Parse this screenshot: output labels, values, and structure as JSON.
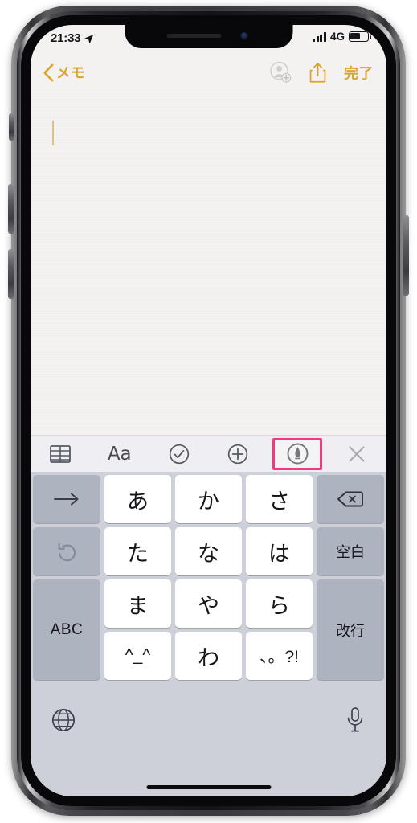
{
  "device": {
    "name": "iPhone X",
    "frame_color": "#3a3a3e"
  },
  "status_bar": {
    "time": "21:33",
    "location_icon": "location-arrow-icon",
    "signal_icon": "signal-bars-icon",
    "signal_bars": 4,
    "network": "4G",
    "battery_icon": "battery-icon",
    "battery_percent": 52
  },
  "nav_bar": {
    "back_icon": "chevron-left-icon",
    "back_label": "メモ",
    "add_person_icon": "person-add-icon",
    "share_icon": "share-icon",
    "done_label": "完了",
    "accent_color": "#d9a52d",
    "disabled_color": "#c9c8c6"
  },
  "note": {
    "body_text": "",
    "caret_color": "#e0c27a",
    "paper_color": "#f4f3f1"
  },
  "note_toolbar": {
    "background": "#efeff3",
    "highlight_color": "#ee3c7f",
    "items": [
      {
        "name": "table-icon",
        "label": "",
        "highlighted": false
      },
      {
        "name": "text-format-icon",
        "label": "Aa",
        "highlighted": false
      },
      {
        "name": "checklist-icon",
        "label": "",
        "highlighted": false
      },
      {
        "name": "add-attachment-icon",
        "label": "",
        "highlighted": false
      },
      {
        "name": "markup-pen-icon",
        "label": "",
        "highlighted": true
      },
      {
        "name": "close-keyboard-icon",
        "label": "",
        "highlighted": false
      }
    ]
  },
  "keyboard": {
    "type": "japanese-kana-flick",
    "background": "#cdd0d8",
    "rows": [
      [
        {
          "name": "key-cursor-right",
          "label": "→",
          "icon": "arrow-right-icon",
          "style": "gray"
        },
        {
          "name": "key-a",
          "label": "あ",
          "icon": "",
          "style": "white"
        },
        {
          "name": "key-ka",
          "label": "か",
          "icon": "",
          "style": "white"
        },
        {
          "name": "key-sa",
          "label": "さ",
          "icon": "",
          "style": "white"
        },
        {
          "name": "key-delete",
          "label": "",
          "icon": "delete-left-icon",
          "style": "gray"
        }
      ],
      [
        {
          "name": "key-undo",
          "label": "",
          "icon": "undo-icon",
          "style": "gray-dim"
        },
        {
          "name": "key-ta",
          "label": "た",
          "icon": "",
          "style": "white"
        },
        {
          "name": "key-na",
          "label": "な",
          "icon": "",
          "style": "white"
        },
        {
          "name": "key-ha",
          "label": "は",
          "icon": "",
          "style": "white"
        },
        {
          "name": "key-space",
          "label": "空白",
          "icon": "",
          "style": "gray"
        }
      ],
      [
        {
          "name": "key-abc",
          "label": "ABC",
          "icon": "",
          "style": "gray"
        },
        {
          "name": "key-ma",
          "label": "ま",
          "icon": "",
          "style": "white"
        },
        {
          "name": "key-ya",
          "label": "や",
          "icon": "",
          "style": "white"
        },
        {
          "name": "key-ra",
          "label": "ら",
          "icon": "",
          "style": "white"
        },
        {
          "name": "key-return",
          "label": "改行",
          "icon": "",
          "style": "gray"
        }
      ],
      [
        {
          "name": "key-emoticon",
          "label": "^_^",
          "icon": "",
          "style": "white"
        },
        {
          "name": "key-wa",
          "label": "わ",
          "icon": "",
          "style": "white"
        },
        {
          "name": "key-punctuation",
          "label": "、。?!",
          "icon": "",
          "style": "white"
        }
      ]
    ],
    "bottom": {
      "globe_icon": "globe-icon",
      "mic_icon": "microphone-icon"
    }
  }
}
